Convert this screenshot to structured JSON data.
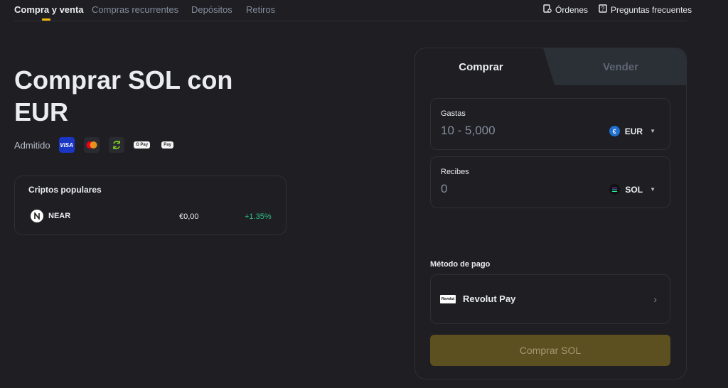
{
  "nav": {
    "tabs": [
      "Compra y venta",
      "Compras recurrentes",
      "Depósitos",
      "Retiros"
    ],
    "orders_label": "Órdenes",
    "faq_label": "Preguntas frecuentes"
  },
  "hero": {
    "title_line1": "Comprar SOL con",
    "title_line2": "EUR",
    "supported_label": "Admitido",
    "payment_icons": [
      "visa-icon",
      "mastercard-icon",
      "sync-icon",
      "google-pay-icon",
      "apple-pay-icon"
    ],
    "visa_text": "VISA",
    "gpay_text": "G Pay",
    "applepay_text": " Pay"
  },
  "popular": {
    "title": "Criptos populares",
    "rows": [
      {
        "symbol": "NEAR",
        "price": "€0,00",
        "change": "+1.35%"
      }
    ]
  },
  "trade": {
    "tab_buy": "Comprar",
    "tab_sell": "Vender",
    "spend": {
      "label": "Gastas",
      "placeholder": "10 - 5,000",
      "currency": "EUR"
    },
    "receive": {
      "label": "Recibes",
      "placeholder": "0",
      "currency": "SOL"
    },
    "method_label": "Método de pago",
    "method_name": "Revolut Pay",
    "revolut_logo_text": "Revolut",
    "button_label": "Comprar SOL"
  },
  "colors": {
    "accent": "#f0b90b",
    "positive": "#2ebd85",
    "background": "#1e1e23",
    "button_disabled": "#5c4f20"
  }
}
